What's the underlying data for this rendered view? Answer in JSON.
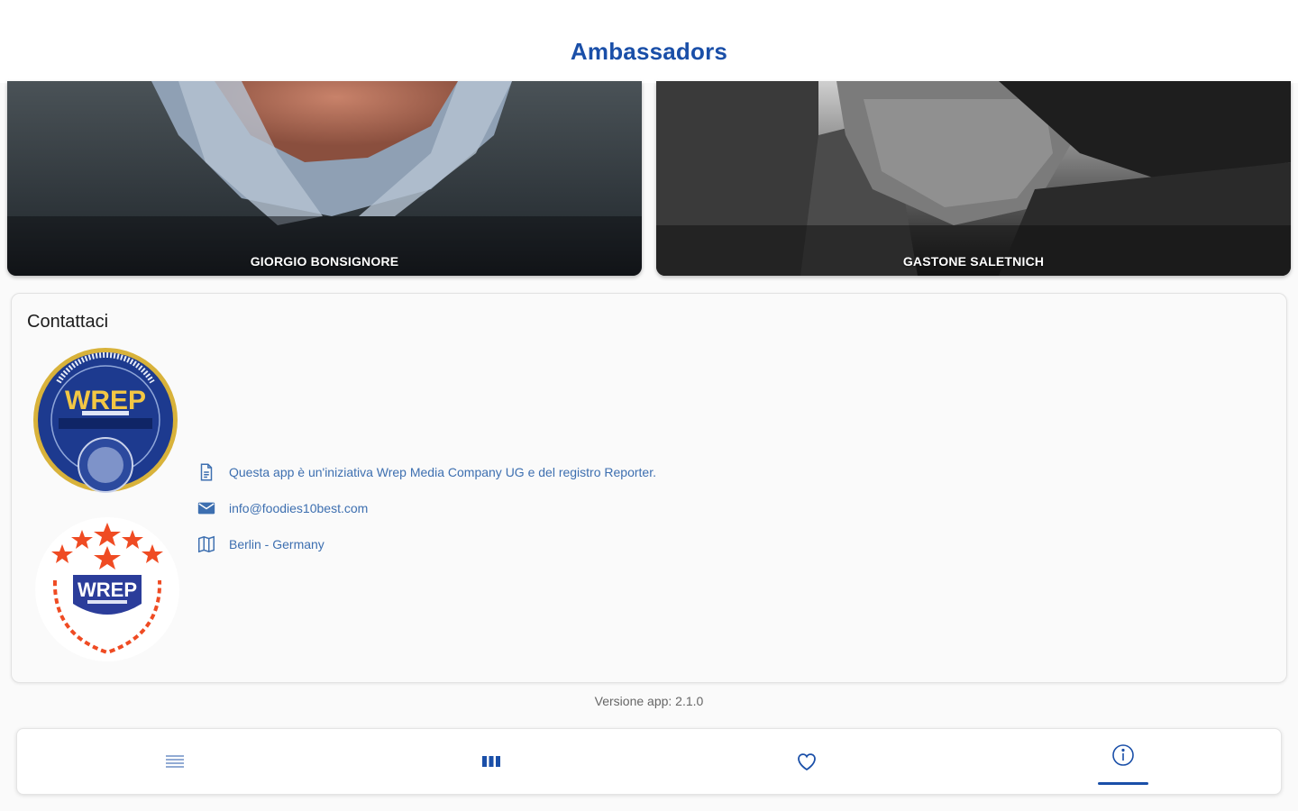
{
  "header": {
    "title": "Ambassadors"
  },
  "ambassadors": [
    {
      "name": "GIORGIO BONSIGNORE"
    },
    {
      "name": "GASTONE SALETNICH"
    }
  ],
  "contact": {
    "title": "Contattaci",
    "logos": [
      {
        "icon": "wrep-seal-logo",
        "text": "WREP"
      },
      {
        "icon": "wrep-laurel-logo",
        "text": "WREP"
      }
    ],
    "items": [
      {
        "icon": "document-icon",
        "text": "Questa app è un'iniziativa Wrep Media Company UG e del registro Reporter."
      },
      {
        "icon": "mail-icon",
        "text": "info@foodies10best.com"
      },
      {
        "icon": "map-icon",
        "text": "Berlin - Germany"
      }
    ]
  },
  "version": {
    "text": "Versione app: 2.1.0"
  },
  "bottom_nav": {
    "items": [
      {
        "icon": "list-icon",
        "active": false
      },
      {
        "icon": "grid-icon",
        "active": false
      },
      {
        "icon": "heart-icon",
        "active": false
      },
      {
        "icon": "info-icon",
        "active": true
      }
    ]
  },
  "colors": {
    "accent": "#1a4fa8",
    "link": "#3d6fb0"
  }
}
